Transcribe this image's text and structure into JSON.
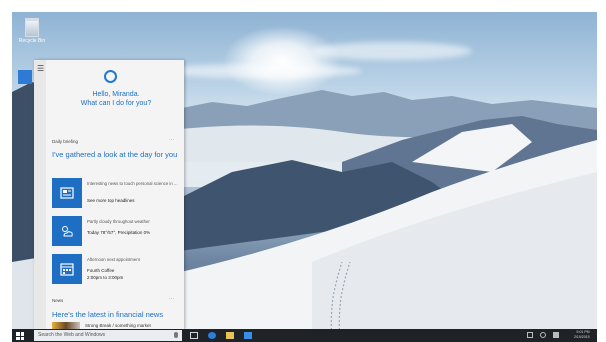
{
  "desktop": {
    "recycle_bin_label": "Recycle Bin"
  },
  "cortana": {
    "greeting_line1": "Hello, Miranda.",
    "greeting_line2": "What can I do for you?",
    "section1_header": "Daily briefing",
    "section1_title": "I've gathered a look at the day for you",
    "cards": [
      {
        "icon": "news-icon",
        "line1": "Interesting news to touch personal science in ...",
        "line2": "See more top headlines",
        "line3": ""
      },
      {
        "icon": "weather-icon",
        "line1": "Partly cloudy throughout weather",
        "line2": "Today 78°/57°, Precipitation 0%",
        "line3": ""
      },
      {
        "icon": "calendar-icon",
        "line1": "Afternoon next appointment",
        "line2": "Fourth Coffee",
        "line3": "2:00pm to 3:00pm"
      }
    ],
    "section2_header": "News",
    "section2_title": "Here's the latest in financial news",
    "news_item": "Strong Break / something market"
  },
  "taskbar": {
    "search_placeholder": "Search the Web and Windows",
    "clock_time": "5:01 PM",
    "clock_date": "2/10/2015"
  },
  "colors": {
    "accent": "#1e6fc4",
    "taskbar": "#1f2328",
    "panel": "#f4f4f4"
  }
}
